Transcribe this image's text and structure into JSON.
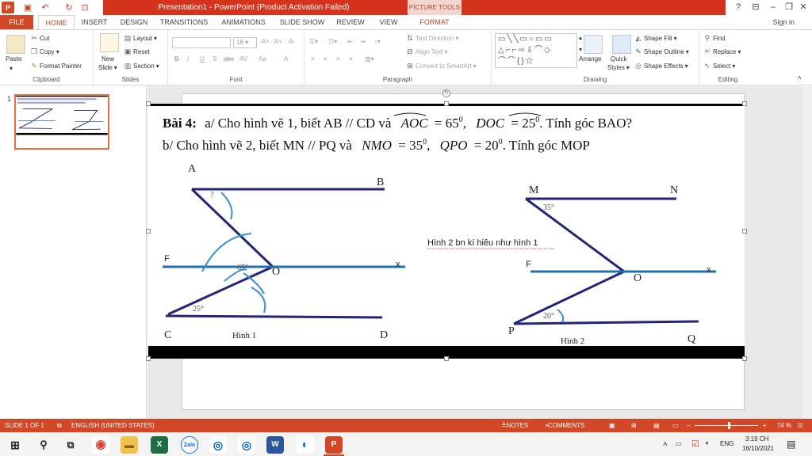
{
  "titlebar": {
    "title": "Presentation1 - PowerPoint (Product Activation Failed)",
    "context_tab": "PICTURE TOOLS",
    "help": "?",
    "minimize": "–",
    "restore": "❐",
    "close": "✕"
  },
  "tabs": [
    "FILE",
    "HOME",
    "INSERT",
    "DESIGN",
    "TRANSITIONS",
    "ANIMATIONS",
    "SLIDE SHOW",
    "REVIEW",
    "VIEW",
    "FORMAT"
  ],
  "signin": "Sign in",
  "ribbon": {
    "clipboard": {
      "label": "Clipboard",
      "paste": "Paste",
      "cut": "Cut",
      "copy": "Copy",
      "format_painter": "Format Painter"
    },
    "slides": {
      "label": "Slides",
      "new_slide": "New",
      "new_slide2": "Slide",
      "layout": "Layout",
      "reset": "Reset",
      "section": "Section"
    },
    "font": {
      "label": "Font",
      "size": "18",
      "bold": "B",
      "italic": "I",
      "underline": "U",
      "shadow": "S",
      "strike": "abc",
      "spacing": "AV",
      "case": "Aa",
      "color": "A"
    },
    "paragraph": {
      "label": "Paragraph",
      "text_direction": "Text Direction",
      "align_text": "Align Text",
      "convert_smartart": "Convert to SmartArt"
    },
    "drawing": {
      "label": "Drawing",
      "arrange": "Arrange",
      "quick_styles": "Quick",
      "quick_styles2": "Styles",
      "shape_fill": "Shape Fill",
      "shape_outline": "Shape Outline",
      "shape_effects": "Shape Effects"
    },
    "editing": {
      "label": "Editing",
      "find": "Find",
      "replace": "Replace",
      "select": "Select"
    }
  },
  "thumbnail": {
    "number": "1"
  },
  "slide": {
    "line1_prefix": "Bài 4:",
    "line1_text": "a/ Cho hình vẽ 1, biết AB // CD và",
    "line1_angle1": "AOC",
    "line1_eq1": "= 65",
    "line1_angle2": "DOC",
    "line1_eq2": "= 25",
    "line1_tail": ". Tính góc BAO?",
    "line2_text": "b/ Cho hình vẽ 2, biết MN // PQ và",
    "line2_angle1": "NMO",
    "line2_eq1": "= 35",
    "line2_angle2": "QPO",
    "line2_eq2": "= 20",
    "line2_tail": ". Tính góc MOP",
    "degree": "0",
    "comma": ",",
    "note": "Hình 2 bn  kí hiêu như  hình 1",
    "fig1": {
      "A": "A",
      "B": "B",
      "C": "C",
      "D": "D",
      "F": "F",
      "O": "O",
      "x": "x",
      "q": "?",
      "a65": "65°",
      "a25": "25°",
      "caption": "Hình 1"
    },
    "fig2": {
      "M": "M",
      "N": "N",
      "P": "P",
      "Q": "Q",
      "F": "F",
      "O": "O",
      "x": "x",
      "a35": "35°",
      "a20": "20°",
      "caption": "Hình 2"
    }
  },
  "statusbar": {
    "slide": "SLIDE 1 OF 1",
    "language": "ENGLISH (UNITED STATES)",
    "notes": "NOTES",
    "comments": "COMMENTS",
    "zoom": "74 %",
    "zoom_level": 0.74
  },
  "taskbar": {
    "lang": "ENG",
    "time": "3:19 CH",
    "date": "16/10/2021",
    "zalo": "Zalo",
    "excel": "X",
    "word": "W",
    "ppt": "P"
  },
  "colors": {
    "accent": "#d24726",
    "navy": "#23237a",
    "blue": "#1f6fb2",
    "arc": "#3a8fd0"
  }
}
